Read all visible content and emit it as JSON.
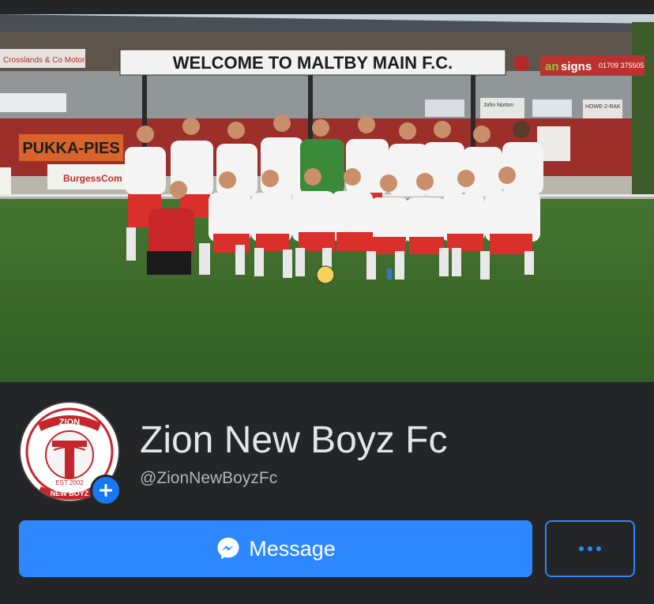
{
  "cover": {
    "banner_main": "WELCOME TO MALTBY MAIN F.C.",
    "banner_left": "Crosslands & Co Motors",
    "sponsor_pies": "PUKKA-PIES",
    "sponsor_burgess": "BurgessCom",
    "sponsor_signs": "signs",
    "sponsor_signs_prefix": "an",
    "sponsor_phone": "01709 375505",
    "board_1": "John Norton",
    "board_2": "HOWE-2-RAK"
  },
  "page": {
    "name": "Zion New Boyz Fc",
    "handle": "@ZionNewBoyzFc",
    "logo_top": "ZION",
    "logo_est": "EST 2002",
    "logo_bottom": "NEW BOYZ"
  },
  "actions": {
    "message_label": "Message",
    "more_label": "More options"
  },
  "colors": {
    "accent": "#2d88ff",
    "background": "#242526",
    "text_primary": "#e4e6eb",
    "text_secondary": "#b0b3b8"
  },
  "icons": {
    "message": "messenger-icon",
    "more": "ellipsis-icon",
    "add": "plus-icon"
  }
}
